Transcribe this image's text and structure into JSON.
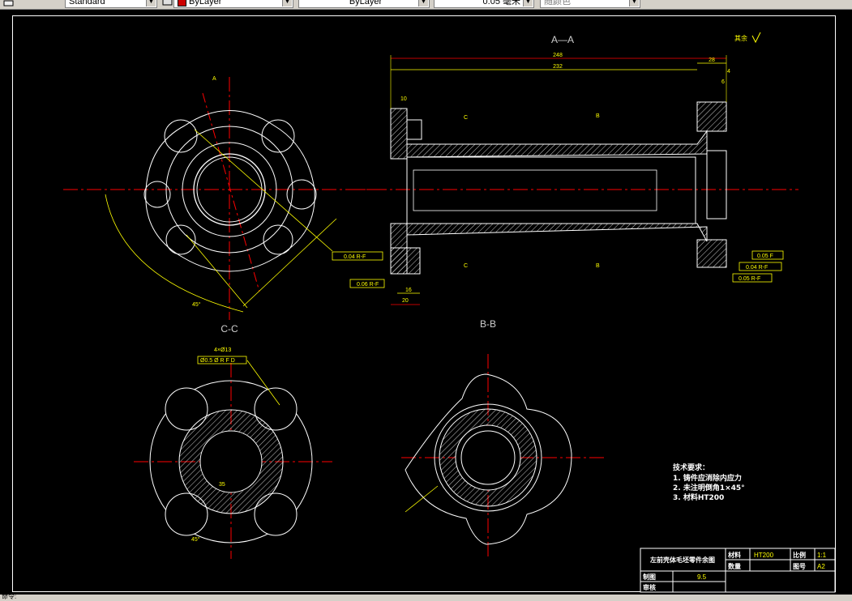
{
  "toolbar": {
    "text_style": "Standard",
    "layer_color_label": "ByLayer",
    "layer_color_hex": "#cc0000",
    "linetype": "ByLayer",
    "lineweight": "0.05 毫米",
    "plot_style": "随颜色"
  },
  "views": {
    "aa": "A—A",
    "cc": "C-C",
    "bb": "B-B"
  },
  "dims": {
    "d248": "248",
    "d232": "232",
    "d28": "28",
    "d6": "6",
    "d4": "4",
    "d10": "10",
    "d16": "16",
    "d20": "20",
    "d35": "35",
    "d4x13": "4×Ø13",
    "d45": "45°",
    "rest": "其余",
    "aA": "A",
    "cC": "C",
    "bB": "B",
    "tol1": "0.04 R-F",
    "tol2": "0.06 R-F",
    "tol3": "0.05 F",
    "tol4": "0.04 R-F",
    "tol5": "0.05 R-F",
    "pos": "Ø0.5 Ø R F D"
  },
  "notes": {
    "title": "技术要求：",
    "n1": "1. 铸件应消除内应力",
    "n2": "2. 未注明倒角1×45°",
    "n3": "3. 材料HT200"
  },
  "title_block": {
    "part_name": "左前壳体毛坯零件余图",
    "material_label": "材料",
    "material_value": "HT200",
    "scale_label": "比例",
    "scale_value": "1:1",
    "qty_label": "数量",
    "drawing_no_label": "图号",
    "drawing_no_value": "A2",
    "drawn_label": "制图",
    "drawn_value": "9.5",
    "check_label": "审核"
  },
  "colors": {
    "canvas": "#000000",
    "geometry": "#ffffff",
    "center_line": "#ff0000",
    "dimension": "#ffff00",
    "hatch": "#ffffff"
  },
  "statusbar": {
    "text": "命令:"
  }
}
